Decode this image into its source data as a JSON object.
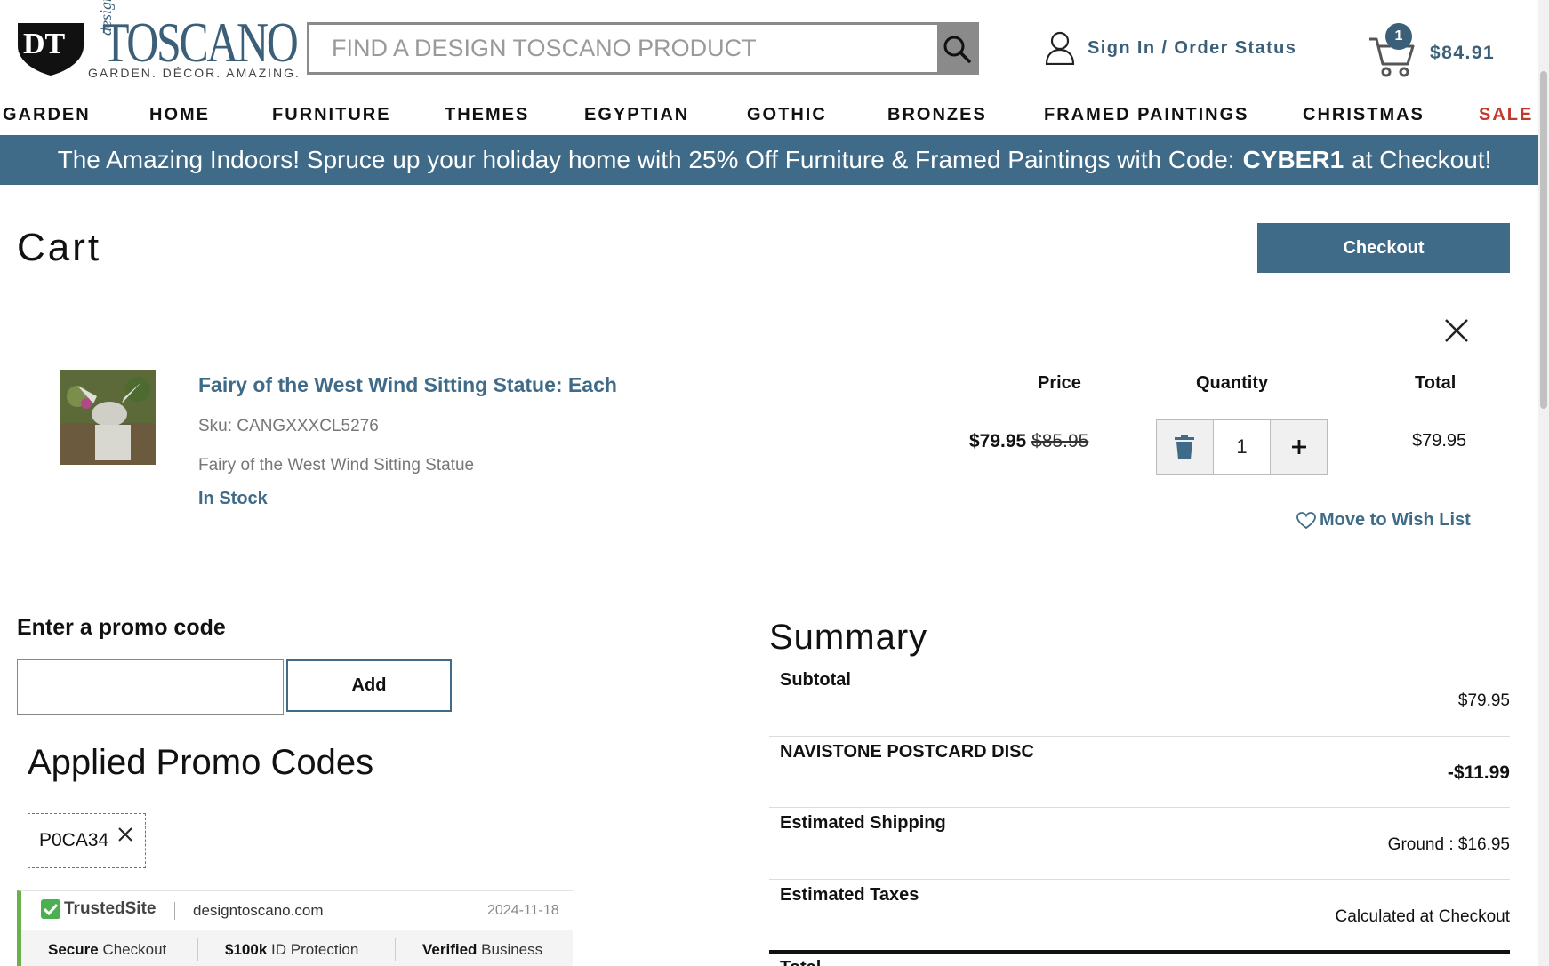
{
  "brand": {
    "logo_mark": "DT",
    "design_word": "design",
    "name": "TOSCANO",
    "tagline": "GARDEN. DÉCOR. AMAZING."
  },
  "search": {
    "placeholder": "FIND A DESIGN TOSCANO PRODUCT",
    "value": ""
  },
  "account": {
    "label": "Sign In / Order Status"
  },
  "mini_cart": {
    "count": "1",
    "total": "$84.91"
  },
  "nav": [
    "GARDEN",
    "HOME",
    "FURNITURE",
    "THEMES",
    "EGYPTIAN",
    "GOTHIC",
    "BRONZES",
    "FRAMED PAINTINGS",
    "CHRISTMAS",
    "SALE"
  ],
  "banner": {
    "before": "The Amazing Indoors! Spruce up your holiday home with 25% Off Furniture & Framed Paintings with Code:",
    "code": "CYBER1",
    "after": "at Checkout!"
  },
  "cart": {
    "title": "Cart",
    "checkout_label": "Checkout",
    "columns": {
      "price": "Price",
      "quantity": "Quantity",
      "total": "Total"
    },
    "items": [
      {
        "name": "Fairy of the West Wind Sitting Statue: Each",
        "sku": "Sku: CANGXXXCL5276",
        "description": "Fairy of the West Wind Sitting Statue",
        "stock": "In Stock",
        "price": "$79.95",
        "original_price": "$85.95",
        "quantity": "1",
        "total": "$79.95",
        "wish_label": "Move to Wish List"
      }
    ]
  },
  "promo": {
    "title": "Enter a promo code",
    "input_value": "",
    "add_label": "Add",
    "applied_title": "Applied Promo Codes",
    "applied": [
      "P0CA34"
    ]
  },
  "trusted": {
    "brand": "TrustedSite",
    "domain": "designtoscano.com",
    "date": "2024-11-18",
    "features": [
      {
        "strong": "Secure",
        "rest": "Checkout"
      },
      {
        "strong": "$100k",
        "rest": "ID Protection"
      },
      {
        "strong": "Verified",
        "rest": "Business"
      }
    ]
  },
  "summary": {
    "title": "Summary",
    "rows": [
      {
        "label": "Subtotal",
        "value": "$79.95"
      },
      {
        "label": "NAVISTONE POSTCARD DISC",
        "value": "-$11.99"
      },
      {
        "label": "Estimated Shipping",
        "value": "Ground : $16.95"
      },
      {
        "label": "Estimated Taxes",
        "value": "Calculated at Checkout"
      }
    ],
    "total_label": "Total"
  },
  "colors": {
    "brand_blue": "#3f6b88",
    "sale_red": "#c0392b",
    "trusted_green": "#6ab04c"
  }
}
